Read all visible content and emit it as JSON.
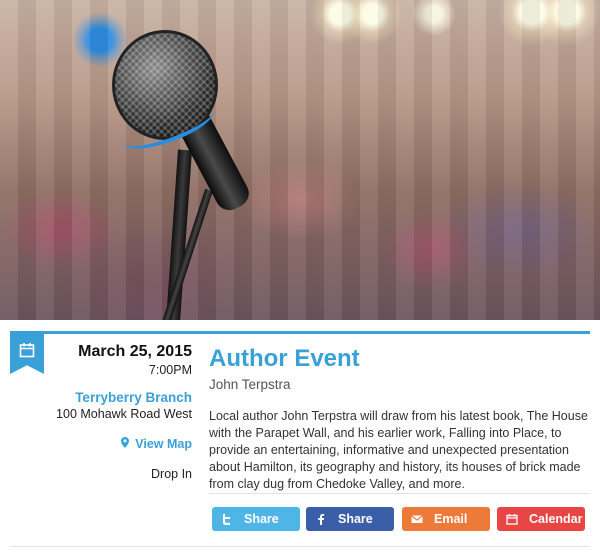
{
  "event": {
    "date": "March 25, 2015",
    "time": "7:00PM",
    "branch": "Terryberry Branch",
    "address": "100 Mohawk Road West",
    "map_link": "View Map",
    "admission": "Drop In",
    "title": "Author Event",
    "author": "John Terpstra",
    "description": "Local author John Terpstra will draw from his latest book, The House with the Parapet Wall, and his earlier work, Falling into Place, to provide an entertaining, informative and unexpected presentation about Hamilton, its geography and history, its houses of brick made from clay dug from Chedoke Valley, and more."
  },
  "share": {
    "twitter_label": "Share",
    "facebook_label": "Share",
    "email_label": "Email",
    "calendar_label": "Calendar"
  },
  "colors": {
    "accent": "#3aa0d8",
    "twitter": "#4eb5e6",
    "facebook": "#3a5fa8",
    "email": "#ee7a3a",
    "calendar": "#e94545"
  },
  "icons": {
    "ribbon": "calendar-icon",
    "map": "map-pin-icon",
    "twitter": "twitter-icon",
    "facebook": "facebook-icon",
    "email": "envelope-icon",
    "calendar": "calendar-icon"
  }
}
